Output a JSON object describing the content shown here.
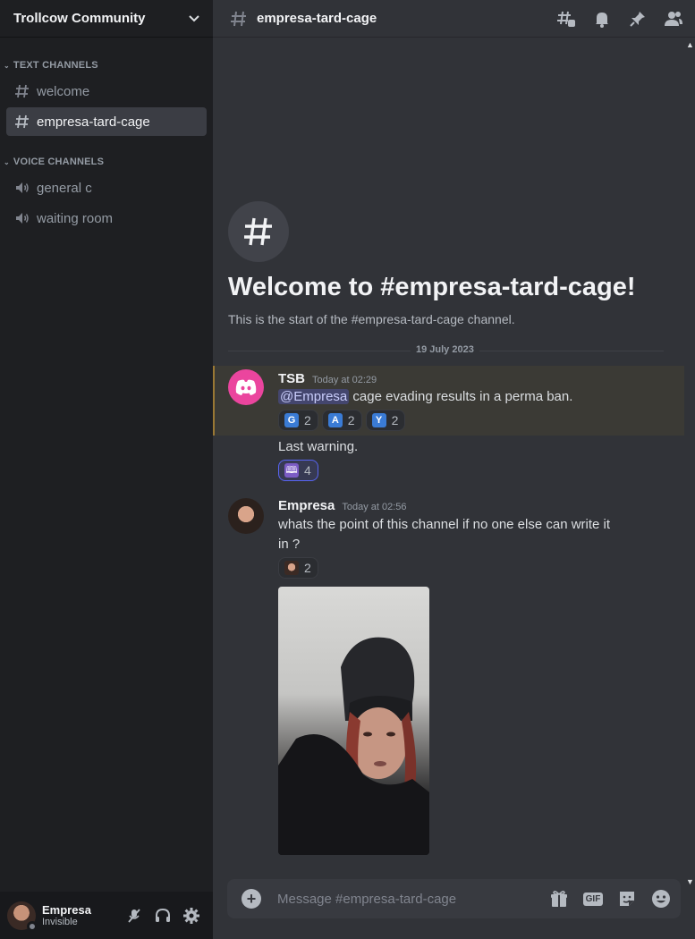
{
  "server": {
    "name": "Trollcow Community"
  },
  "sidebar": {
    "categories": [
      {
        "label": "TEXT CHANNELS",
        "channels": [
          {
            "label": "welcome",
            "icon": "hash-icon"
          },
          {
            "label": "empresa-tard-cage",
            "icon": "hash-icon",
            "active": true
          }
        ]
      },
      {
        "label": "VOICE CHANNELS",
        "channels": [
          {
            "label": "general c",
            "icon": "speaker-icon"
          },
          {
            "label": "waiting room",
            "icon": "speaker-icon"
          }
        ]
      }
    ]
  },
  "user_panel": {
    "name": "Empresa",
    "status": "Invisible"
  },
  "channel": {
    "name": "empresa-tard-cage",
    "welcome_title": "Welcome to #empresa-tard-cage!",
    "welcome_sub": "This is the start of the #empresa-tard-cage channel."
  },
  "divider_date": "19 July 2023",
  "messages": [
    {
      "author": "TSB",
      "time": "Today at 02:29",
      "mention": "@Empresa",
      "text": " cage evading results in a perma ban.",
      "reactions": [
        {
          "emoji": "G",
          "count": "2"
        },
        {
          "emoji": "A",
          "count": "2"
        },
        {
          "emoji": "Y",
          "count": "2"
        }
      ],
      "followup_text": "Last warning.",
      "followup_reactions": [
        {
          "emoji": "menorah",
          "count": "4"
        }
      ]
    },
    {
      "author": "Empresa",
      "time": "Today at 02:56",
      "text_line1": "whats the point of this channel if no one else can write it",
      "text_line2": "in ?",
      "reactions": [
        {
          "emoji": "face",
          "count": "2"
        }
      ]
    }
  ],
  "composer": {
    "placeholder": "Message #empresa-tard-cage",
    "gif_label": "GIF"
  },
  "colors": {
    "accent": "#5865f2",
    "tsb_avatar": "#eb459e",
    "highlight_bar": "#f0b232"
  }
}
